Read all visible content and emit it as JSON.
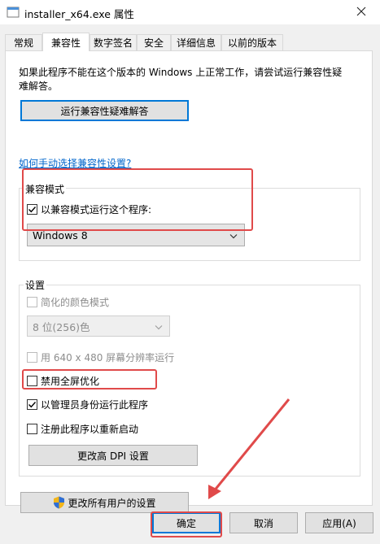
{
  "window": {
    "title": "installer_x64.exe 属性"
  },
  "tabs": [
    {
      "label": "常规"
    },
    {
      "label": "兼容性"
    },
    {
      "label": "数字签名"
    },
    {
      "label": "安全"
    },
    {
      "label": "详细信息"
    },
    {
      "label": "以前的版本"
    }
  ],
  "compat": {
    "description": "如果此程序不能在这个版本的 Windows 上正常工作，请尝试运行兼容性疑难解答。",
    "troubleshoot_button": "运行兼容性疑难解答",
    "manual_link": "如何手动选择兼容性设置?"
  },
  "compat_mode": {
    "group_label": "兼容模式",
    "checkbox_label": "以兼容模式运行这个程序:",
    "selected_os": "Windows 8"
  },
  "settings": {
    "group_label": "设置",
    "reduced_color": "简化的颜色模式",
    "color_depth": "8 位(256)色",
    "low_res": "用 640 x 480 屏幕分辨率运行",
    "disable_fullscreen": "禁用全屏优化",
    "run_as_admin": "以管理员身份运行此程序",
    "register_restart": "注册此程序以重新启动",
    "dpi_button": "更改高 DPI 设置"
  },
  "all_users_button": "更改所有用户的设置",
  "footer": {
    "ok": "确定",
    "cancel": "取消",
    "apply": "应用(A)"
  }
}
